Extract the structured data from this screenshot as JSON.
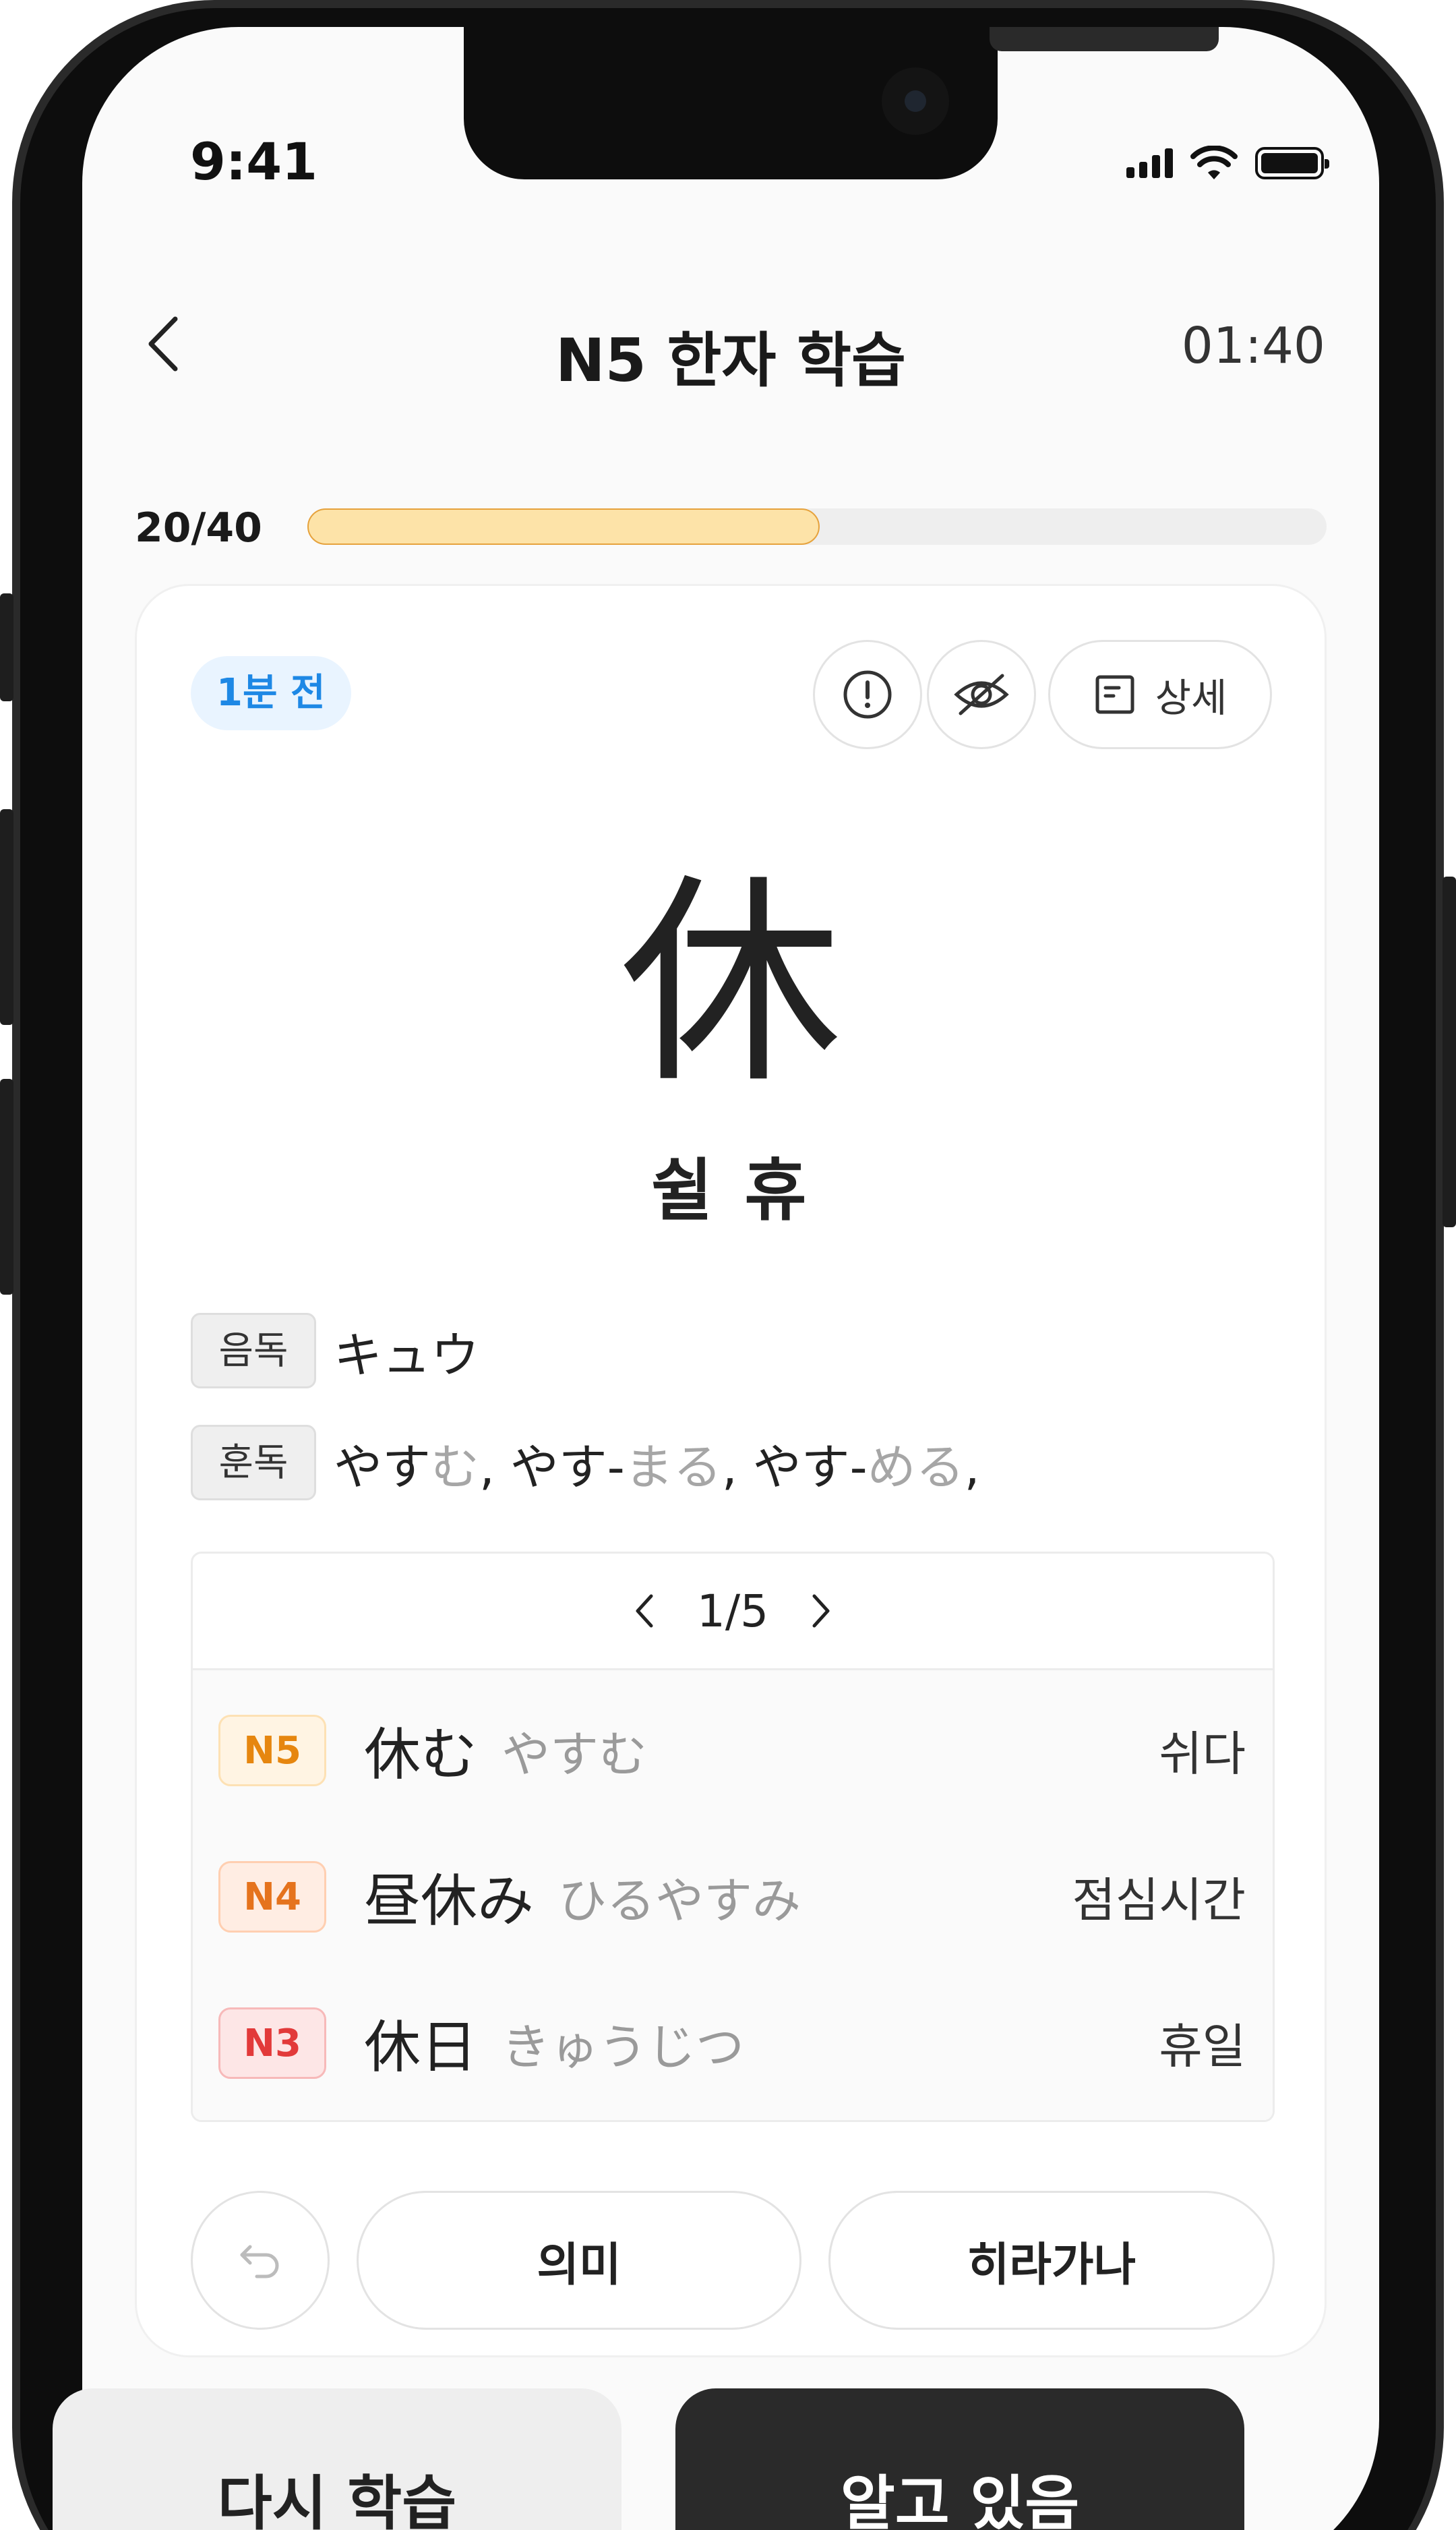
{
  "status_bar": {
    "time": "9:41"
  },
  "header": {
    "title": "N5 한자 학습",
    "timer": "01:40"
  },
  "progress": {
    "count": "20/40",
    "fraction": 0.5
  },
  "card": {
    "time_badge": "1분 전",
    "detail_label": "상세",
    "kanji": "休",
    "meaning": "쉴 휴",
    "on_reading": {
      "label": "음독",
      "text": "キュウ"
    },
    "kun_reading": {
      "label": "훈독",
      "parts": [
        {
          "text": "やす",
          "dim": false
        },
        {
          "text": "む",
          "dim": true
        },
        {
          "text": ", やす-",
          "dim": false
        },
        {
          "text": "まる",
          "dim": true
        },
        {
          "text": ", やす-",
          "dim": false
        },
        {
          "text": "める",
          "dim": true
        },
        {
          "text": ",",
          "dim": false
        }
      ]
    },
    "vocab": {
      "pager": "1/5",
      "rows": [
        {
          "level": "N5",
          "word": "休む",
          "kana": "やすむ",
          "meaning": "쉬다",
          "level_color": "#e6860f",
          "level_bg": "#fff4e3",
          "level_border": "#fde1b4"
        },
        {
          "level": "N4",
          "word": "昼休み",
          "kana": "ひるやすみ",
          "meaning": "점심시간",
          "level_color": "#e5731d",
          "level_bg": "#ffede3",
          "level_border": "#ffcfb1"
        },
        {
          "level": "N3",
          "word": "休日",
          "kana": "きゅうじつ",
          "meaning": "휴일",
          "level_color": "#e23a3a",
          "level_bg": "#fde6e6",
          "level_border": "#f7b9b9"
        }
      ]
    },
    "buttons": {
      "meaning": "의미",
      "hiragana": "히라가나"
    }
  },
  "bottom": {
    "again": "다시 학습",
    "know": "알고 있음"
  },
  "colors": {
    "accent_blue": "#1e88e5",
    "progress_fill": "#fde3a8",
    "dark_button": "#2a2a2a"
  }
}
